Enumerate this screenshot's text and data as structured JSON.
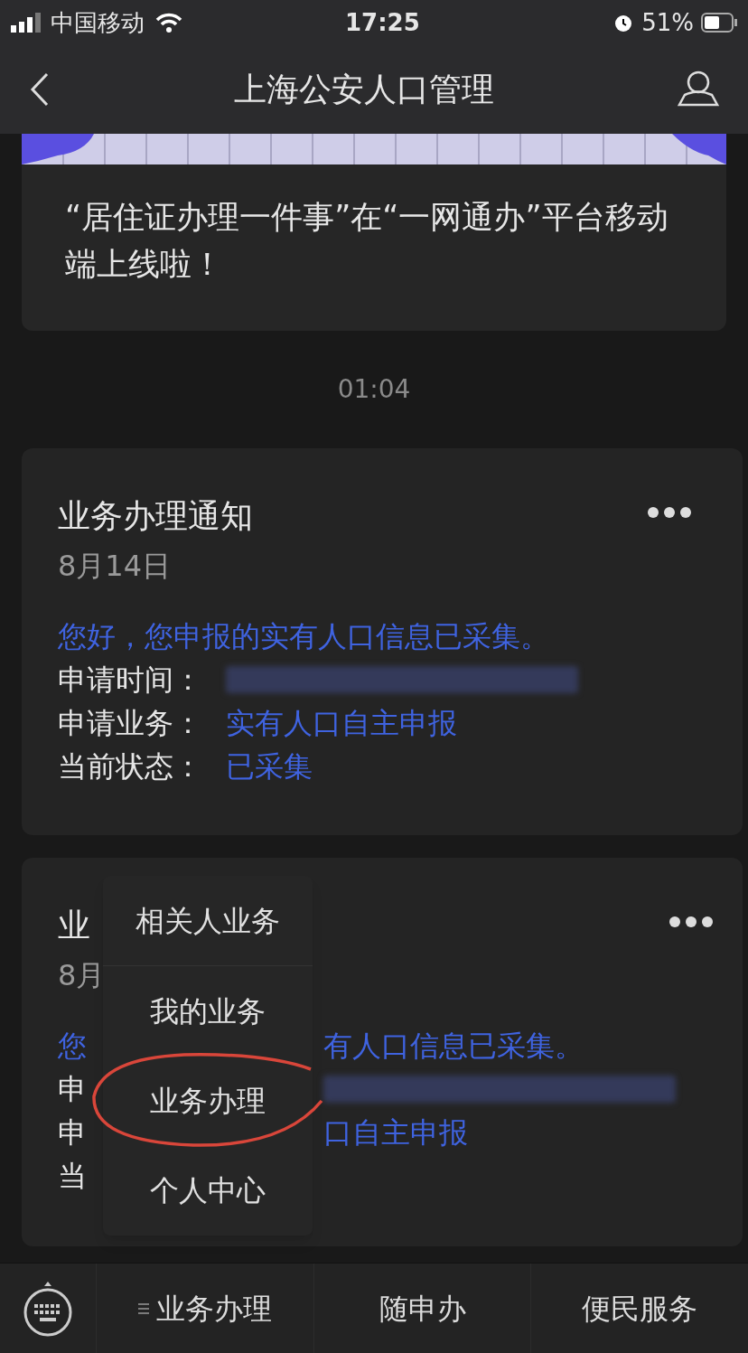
{
  "status_bar": {
    "carrier": "中国移动",
    "time": "17:25",
    "battery": "51%"
  },
  "nav": {
    "title": "上海公安人口管理"
  },
  "banner": {
    "kind": "picture",
    "text": "“居住证办理一件事”在“一网通办”平台移动端上线啦！"
  },
  "timestamp": "01:04",
  "card": {
    "title": "业务办理通知",
    "date": "8月14日",
    "greeting": "您好，您申报的实有人口信息已采集。",
    "fields": [
      {
        "label": "申请时间：",
        "redacted": true
      },
      {
        "label": "申请业务：",
        "value": "实有人口自主申报",
        "redacted": false
      },
      {
        "label": "当前状态：",
        "value": "已采集",
        "redacted": false
      }
    ]
  },
  "card_partial": {
    "title": "业",
    "date": "8月",
    "greeting_left": "您",
    "greeting_right": "有人口信息已采集。",
    "fields": [
      {
        "label": "申",
        "redacted": true
      },
      {
        "label": "申",
        "value": "口自主申报",
        "redacted": false
      },
      {
        "label": "当",
        "redacted": false
      }
    ]
  },
  "popup_menu": [
    {
      "label": "相关人业务",
      "circled": false
    },
    {
      "label": "我的业务",
      "circled": false
    },
    {
      "label": "业务办理",
      "circled": true
    },
    {
      "label": "个人中心",
      "circled": false
    }
  ],
  "bottom_menu": [
    {
      "label": "业务办理",
      "has_menu_icon": true
    },
    {
      "label": "随申办",
      "has_menu_icon": false
    },
    {
      "label": "便民服务",
      "has_menu_icon": false
    }
  ]
}
